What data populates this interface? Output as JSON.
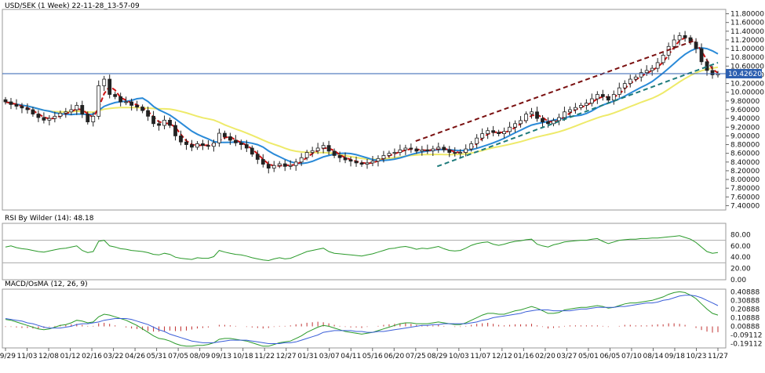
{
  "chart_data": [
    {
      "type": "candlestick",
      "title": "USD/SEK (1 Week) 22-11-28_13-57-09",
      "current_price_label": "10.42620",
      "current_price": 10.4262,
      "ylim": [
        7.3,
        11.9
      ],
      "y_ticks": [
        "11.80000",
        "11.60000",
        "11.40000",
        "11.20000",
        "11.00000",
        "10.80000",
        "10.60000",
        "10.40000",
        "10.20000",
        "10.00000",
        "9.80000",
        "9.60000",
        "9.40000",
        "9.20000",
        "9.00000",
        "8.80000",
        "8.60000",
        "8.40000",
        "8.20000",
        "8.00000",
        "7.80000",
        "7.60000",
        "7.40000"
      ],
      "x_ticks": [
        "09/29",
        "11/03",
        "12/08",
        "01/12",
        "02/16",
        "03/22",
        "04/26",
        "05/31",
        "07/05",
        "08/09",
        "09/13",
        "10/18",
        "11/22",
        "12/27",
        "01/31",
        "03/07",
        "04/11",
        "05/16",
        "06/20",
        "07/25",
        "08/29",
        "10/03",
        "11/07",
        "12/12",
        "01/16",
        "02/20",
        "03/27",
        "05/01",
        "06/05",
        "07/10",
        "08/14",
        "09/18",
        "10/23",
        "11/27"
      ],
      "close_series": [
        9.78,
        9.72,
        9.68,
        9.64,
        9.6,
        9.5,
        9.42,
        9.36,
        9.4,
        9.45,
        9.52,
        9.55,
        9.6,
        9.7,
        9.5,
        9.32,
        9.45,
        10.15,
        10.3,
        9.95,
        9.9,
        9.78,
        9.78,
        9.7,
        9.66,
        9.58,
        9.45,
        9.28,
        9.24,
        9.36,
        9.24,
        9.0,
        8.86,
        8.8,
        8.74,
        8.82,
        8.78,
        8.76,
        8.84,
        9.06,
        8.98,
        8.9,
        8.84,
        8.8,
        8.72,
        8.58,
        8.46,
        8.35,
        8.26,
        8.32,
        8.36,
        8.3,
        8.32,
        8.4,
        8.5,
        8.62,
        8.66,
        8.72,
        8.78,
        8.65,
        8.55,
        8.5,
        8.45,
        8.42,
        8.38,
        8.35,
        8.38,
        8.42,
        8.48,
        8.55,
        8.6,
        8.62,
        8.68,
        8.72,
        8.7,
        8.65,
        8.68,
        8.66,
        8.7,
        8.74,
        8.68,
        8.62,
        8.6,
        8.62,
        8.7,
        8.82,
        8.95,
        9.05,
        9.12,
        9.08,
        9.05,
        9.1,
        9.2,
        9.28,
        9.35,
        9.5,
        9.55,
        9.4,
        9.32,
        9.28,
        9.35,
        9.42,
        9.55,
        9.6,
        9.65,
        9.7,
        9.75,
        9.85,
        9.95,
        9.9,
        9.82,
        9.95,
        10.1,
        10.2,
        10.3,
        10.35,
        10.45,
        10.5,
        10.55,
        10.68,
        10.85,
        11.05,
        11.2,
        11.3,
        11.25,
        11.15,
        11.0,
        10.7,
        10.5,
        10.4,
        10.43
      ],
      "moving_averages": [
        {
          "color": "#cc1111",
          "style": "dashed",
          "label": "fast MA"
        },
        {
          "color": "#2a8ad8",
          "style": "solid",
          "label": "medium MA"
        },
        {
          "color": "#eeea6a",
          "style": "solid",
          "label": "slow MA"
        }
      ],
      "trend_lines": [
        {
          "color": "#7a1010",
          "style": "dashed",
          "from": [
            "07/25",
            8.88
          ],
          "to": [
            "10/23",
            11.2
          ]
        },
        {
          "color": "#1e7b7b",
          "style": "dashed",
          "from": [
            "08/29",
            8.3
          ],
          "to": [
            "11/27",
            10.68
          ]
        }
      ]
    },
    {
      "type": "line",
      "title": "RSI By Wilder (14): 48.18",
      "ylim": [
        0,
        100
      ],
      "y_ticks": [
        "80.00",
        "60.00",
        "40.00",
        "20.00",
        "0.00"
      ],
      "levels": [
        70,
        30
      ],
      "series": [
        {
          "color": "#2a9a2a",
          "values": [
            58,
            60,
            57,
            55,
            54,
            52,
            50,
            49,
            51,
            53,
            55,
            56,
            58,
            60,
            52,
            48,
            50,
            68,
            70,
            60,
            58,
            55,
            54,
            52,
            51,
            50,
            48,
            45,
            44,
            47,
            45,
            40,
            38,
            37,
            36,
            39,
            38,
            38,
            41,
            52,
            49,
            47,
            45,
            44,
            42,
            39,
            37,
            35,
            34,
            37,
            39,
            37,
            38,
            42,
            46,
            50,
            52,
            54,
            56,
            50,
            47,
            46,
            45,
            44,
            43,
            42,
            44,
            46,
            49,
            52,
            55,
            56,
            58,
            59,
            57,
            54,
            56,
            55,
            57,
            59,
            55,
            52,
            51,
            52,
            56,
            61,
            64,
            66,
            67,
            63,
            61,
            63,
            66,
            68,
            69,
            71,
            72,
            63,
            60,
            58,
            62,
            64,
            67,
            68,
            69,
            70,
            70,
            72,
            73,
            68,
            64,
            67,
            70,
            71,
            72,
            72,
            73,
            73,
            74,
            74,
            75,
            76,
            77,
            78,
            75,
            72,
            66,
            58,
            50,
            47,
            48.18
          ]
        }
      ]
    },
    {
      "type": "line+bar",
      "title": "MACD/OsMA (12, 26, 9)",
      "ylim": [
        -0.24,
        0.44
      ],
      "y_ticks": [
        "0.40888",
        "0.30888",
        "0.20888",
        "0.10888",
        "0.00888",
        "-0.09112",
        "-0.19112"
      ],
      "series": [
        {
          "name": "",
          "color": "#2a9a2a",
          "values": [
            0.09,
            0.08,
            0.06,
            0.04,
            0.02,
            0.0,
            -0.02,
            -0.03,
            -0.02,
            0.0,
            0.02,
            0.03,
            0.05,
            0.08,
            0.07,
            0.05,
            0.06,
            0.12,
            0.15,
            0.14,
            0.12,
            0.1,
            0.08,
            0.05,
            0.02,
            -0.02,
            -0.06,
            -0.1,
            -0.13,
            -0.14,
            -0.16,
            -0.19,
            -0.21,
            -0.22,
            -0.22,
            -0.21,
            -0.21,
            -0.2,
            -0.18,
            -0.14,
            -0.13,
            -0.13,
            -0.14,
            -0.15,
            -0.16,
            -0.18,
            -0.2,
            -0.22,
            -0.22,
            -0.2,
            -0.18,
            -0.17,
            -0.16,
            -0.13,
            -0.1,
            -0.06,
            -0.03,
            0.0,
            0.02,
            0.01,
            -0.01,
            -0.03,
            -0.05,
            -0.06,
            -0.07,
            -0.08,
            -0.07,
            -0.06,
            -0.04,
            -0.02,
            0.0,
            0.02,
            0.04,
            0.05,
            0.05,
            0.04,
            0.04,
            0.04,
            0.05,
            0.06,
            0.05,
            0.04,
            0.03,
            0.03,
            0.05,
            0.08,
            0.11,
            0.14,
            0.16,
            0.16,
            0.15,
            0.15,
            0.17,
            0.19,
            0.2,
            0.22,
            0.24,
            0.22,
            0.19,
            0.16,
            0.16,
            0.17,
            0.2,
            0.21,
            0.22,
            0.23,
            0.23,
            0.24,
            0.25,
            0.24,
            0.22,
            0.23,
            0.25,
            0.27,
            0.28,
            0.28,
            0.29,
            0.3,
            0.31,
            0.33,
            0.35,
            0.38,
            0.4,
            0.41,
            0.4,
            0.37,
            0.33,
            0.27,
            0.21,
            0.16,
            0.14
          ]
        },
        {
          "name": "",
          "color": "#3a5ed8",
          "values": [
            0.1,
            0.09,
            0.08,
            0.07,
            0.05,
            0.04,
            0.02,
            0.0,
            -0.01,
            -0.01,
            -0.01,
            0.0,
            0.01,
            0.03,
            0.04,
            0.04,
            0.05,
            0.06,
            0.08,
            0.09,
            0.1,
            0.1,
            0.1,
            0.09,
            0.07,
            0.05,
            0.03,
            0.0,
            -0.03,
            -0.05,
            -0.08,
            -0.1,
            -0.12,
            -0.14,
            -0.16,
            -0.17,
            -0.18,
            -0.18,
            -0.18,
            -0.17,
            -0.16,
            -0.15,
            -0.15,
            -0.15,
            -0.15,
            -0.16,
            -0.17,
            -0.18,
            -0.19,
            -0.19,
            -0.19,
            -0.18,
            -0.18,
            -0.17,
            -0.15,
            -0.13,
            -0.11,
            -0.09,
            -0.06,
            -0.05,
            -0.04,
            -0.04,
            -0.04,
            -0.04,
            -0.05,
            -0.05,
            -0.06,
            -0.06,
            -0.05,
            -0.05,
            -0.04,
            -0.03,
            -0.02,
            -0.01,
            0.0,
            0.01,
            0.02,
            0.02,
            0.03,
            0.03,
            0.04,
            0.04,
            0.04,
            0.04,
            0.04,
            0.05,
            0.06,
            0.08,
            0.09,
            0.11,
            0.12,
            0.13,
            0.14,
            0.15,
            0.16,
            0.18,
            0.19,
            0.2,
            0.2,
            0.2,
            0.19,
            0.19,
            0.19,
            0.19,
            0.2,
            0.21,
            0.21,
            0.22,
            0.23,
            0.23,
            0.23,
            0.23,
            0.24,
            0.24,
            0.25,
            0.26,
            0.27,
            0.28,
            0.28,
            0.29,
            0.31,
            0.32,
            0.34,
            0.36,
            0.37,
            0.37,
            0.36,
            0.34,
            0.31,
            0.28,
            0.25
          ]
        }
      ]
    }
  ]
}
